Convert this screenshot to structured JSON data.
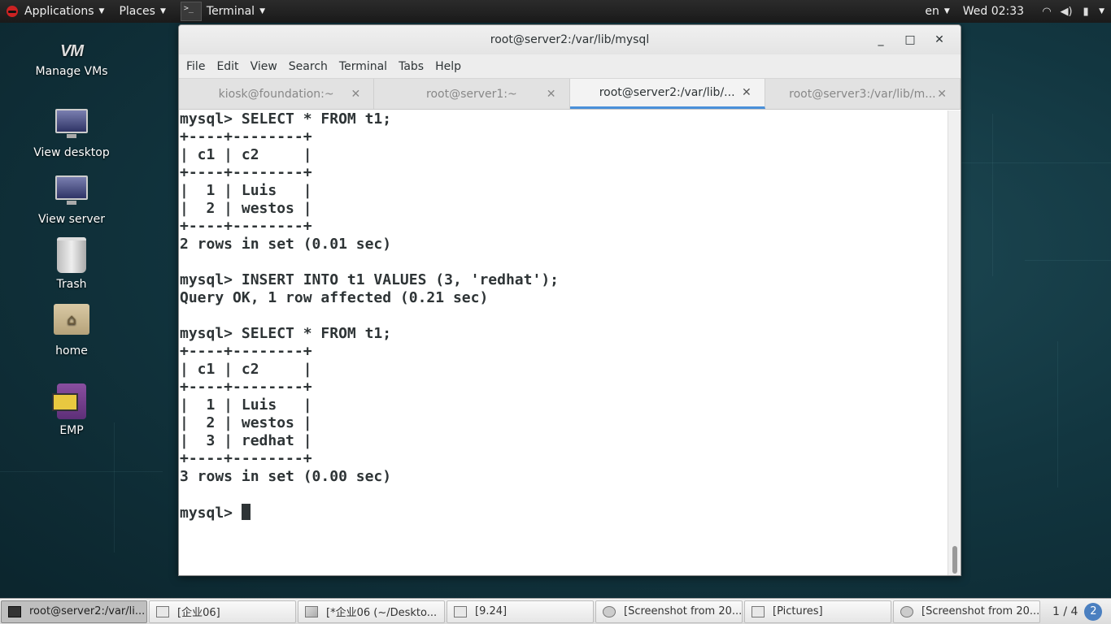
{
  "top_panel": {
    "applications": "Applications",
    "places": "Places",
    "terminal_app": "Terminal",
    "language": "en",
    "clock": "Wed 02:33",
    "icons": [
      "wifi-icon",
      "volume-icon",
      "battery-icon"
    ]
  },
  "desktop_icons": [
    {
      "label": "Manage VMs",
      "icon": "vm-logo-icon"
    },
    {
      "label": "View desktop",
      "icon": "monitor-icon"
    },
    {
      "label": "View server",
      "icon": "monitor-icon"
    },
    {
      "label": "Trash",
      "icon": "trash-icon"
    },
    {
      "label": "home",
      "icon": "home-folder-icon"
    },
    {
      "label": "EMP",
      "icon": "emp-app-icon"
    }
  ],
  "window": {
    "title": "root@server2:/var/lib/mysql",
    "menu": [
      "File",
      "Edit",
      "View",
      "Search",
      "Terminal",
      "Tabs",
      "Help"
    ],
    "tabs": [
      {
        "label": "kiosk@foundation:~",
        "active": false
      },
      {
        "label": "root@server1:~",
        "active": false
      },
      {
        "label": "root@server2:/var/lib/...",
        "active": true
      },
      {
        "label": "root@server3:/var/lib/m...",
        "active": false
      }
    ],
    "terminal_lines": [
      "mysql> SELECT * FROM t1;",
      "+----+--------+",
      "| c1 | c2     |",
      "+----+--------+",
      "|  1 | Luis   |",
      "|  2 | westos |",
      "+----+--------+",
      "2 rows in set (0.01 sec)",
      "",
      "mysql> INSERT INTO t1 VALUES (3, 'redhat');",
      "Query OK, 1 row affected (0.21 sec)",
      "",
      "mysql> SELECT * FROM t1;",
      "+----+--------+",
      "| c1 | c2     |",
      "+----+--------+",
      "|  1 | Luis   |",
      "|  2 | westos |",
      "|  3 | redhat |",
      "+----+--------+",
      "3 rows in set (0.00 sec)",
      ""
    ],
    "prompt": "mysql> "
  },
  "taskbar": {
    "tasks": [
      {
        "label": "root@server2:/var/li...",
        "icon": "terminal-icon",
        "active": true
      },
      {
        "label": "[企业06]",
        "icon": "window-icon",
        "active": false
      },
      {
        "label": "[*企业06 (~/Deskto...",
        "icon": "text-editor-icon",
        "active": false
      },
      {
        "label": "[9.24]",
        "icon": "window-icon",
        "active": false
      },
      {
        "label": "[Screenshot from 20...",
        "icon": "screenshot-icon",
        "active": false
      },
      {
        "label": "[Pictures]",
        "icon": "window-icon",
        "active": false
      },
      {
        "label": "[Screenshot from 20...",
        "icon": "screenshot-icon",
        "active": false
      }
    ],
    "workspace": "1 / 4",
    "badge": "2"
  }
}
